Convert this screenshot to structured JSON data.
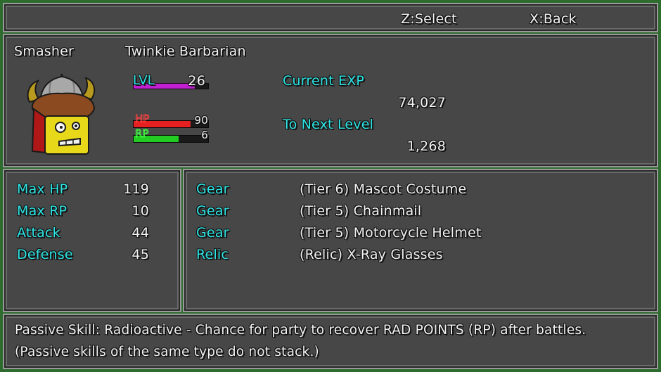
{
  "header": {
    "select_label": "Z:Select",
    "back_label": "X:Back"
  },
  "character": {
    "name": "Smasher",
    "class": "Twinkie Barbarian",
    "lvl_label": "LVL",
    "level": "26",
    "hp_label": "HP",
    "hp_value": "90",
    "hp_fraction": 0.76,
    "rp_label": "RP",
    "rp_value": "6",
    "rp_fraction": 0.6,
    "lvl_fraction": 0.82,
    "current_exp_label": "Current EXP",
    "current_exp": "74,027",
    "next_level_label": "To Next Level",
    "next_level": "1,268"
  },
  "stats": [
    {
      "label": "Max HP",
      "value": "119"
    },
    {
      "label": "Max RP",
      "value": "10"
    },
    {
      "label": "Attack",
      "value": "44"
    },
    {
      "label": "Defense",
      "value": "45"
    }
  ],
  "equipment": [
    {
      "slot": "Gear",
      "item": "(Tier 6) Mascot Costume"
    },
    {
      "slot": "Gear",
      "item": "(Tier 5) Chainmail"
    },
    {
      "slot": "Gear",
      "item": "(Tier 5) Motorcycle Helmet"
    },
    {
      "slot": "Relic",
      "item": "(Relic) X-Ray Glasses"
    }
  ],
  "passive": {
    "line1": "Passive Skill: Radioactive - Chance for party to recover RAD POINTS (RP) after battles.",
    "line2": "(Passive skills of the same type do not stack.)"
  },
  "colors": {
    "accent": "#2fe6e6",
    "hp": "#e62020",
    "rp": "#22cc22",
    "lvl": "#c020d0"
  }
}
